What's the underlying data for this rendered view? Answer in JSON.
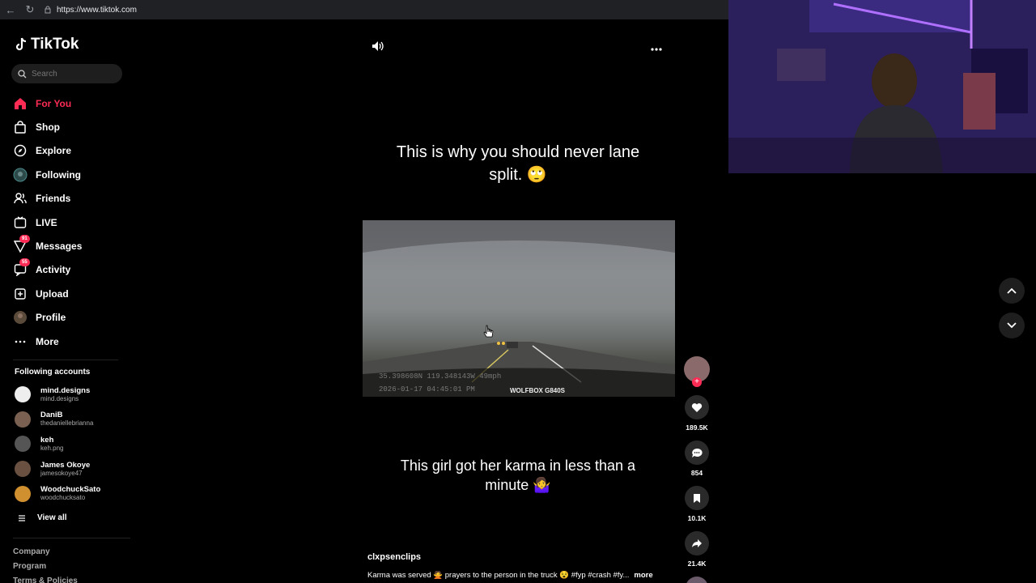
{
  "browser": {
    "url": "https://www.tiktok.com"
  },
  "sidebar": {
    "logo": "TikTok",
    "search_placeholder": "Search",
    "nav": [
      {
        "label": "For You",
        "icon": "home-icon"
      },
      {
        "label": "Shop",
        "icon": "shop-icon"
      },
      {
        "label": "Explore",
        "icon": "compass-icon"
      },
      {
        "label": "Following",
        "icon": "following-avatar-icon"
      },
      {
        "label": "Friends",
        "icon": "friends-icon"
      },
      {
        "label": "LIVE",
        "icon": "live-icon"
      },
      {
        "label": "Messages",
        "icon": "messages-icon",
        "badge": "91"
      },
      {
        "label": "Activity",
        "icon": "activity-icon",
        "badge": "55"
      },
      {
        "label": "Upload",
        "icon": "upload-icon"
      },
      {
        "label": "Profile",
        "icon": "profile-avatar-icon"
      },
      {
        "label": "More",
        "icon": "more-dots-icon"
      }
    ],
    "following_title": "Following accounts",
    "accounts": [
      {
        "name": "mind.designs",
        "handle": "mind.designs"
      },
      {
        "name": "DaniB",
        "handle": "thedaniellebrianna"
      },
      {
        "name": "keh",
        "handle": "keh.png"
      },
      {
        "name": "James Okoye",
        "handle": "jamesokoye47"
      },
      {
        "name": "WoodchuckSato",
        "handle": "woodchucksato"
      }
    ],
    "view_all": "View all",
    "footer": [
      "Company",
      "Program",
      "Terms & Policies"
    ]
  },
  "video": {
    "caption_top": "This is why you should never lane split. 🙄",
    "caption_bottom": "This girl got her karma in less than a minute 🤷‍♀️",
    "overlay_line1": "35.398608N 119.348143W   49mph",
    "overlay_line2": "2026-01-17    04:45:01  PM",
    "overlay_brand": "WOLFBOX G840S",
    "author": "clxpsenclips",
    "description": "Karma was served 🙅 prayers to the person in the truck 😵 #fyp #crash #fy...",
    "more_label": "more"
  },
  "actions": {
    "likes": "189.5K",
    "comments": "854",
    "saves": "10.1K",
    "shares": "21.4K"
  },
  "colors": {
    "accent": "#fe2c55",
    "background": "#000000"
  }
}
